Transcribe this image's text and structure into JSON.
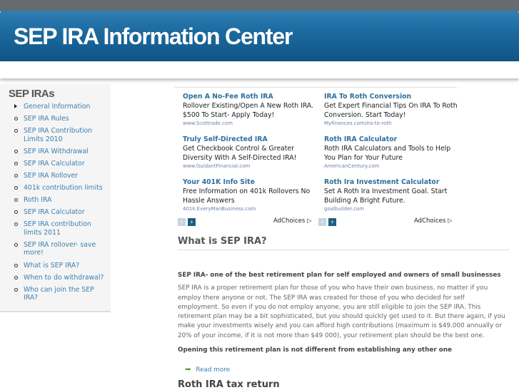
{
  "header": {
    "title": "SEP IRA Information Center"
  },
  "sidebar": {
    "title": "SEP IRAs",
    "items": [
      "General Information",
      "SEP IRA Rules",
      "SEP IRA Contribution Limits 2010",
      "SEP IRA Withdrawal",
      "SEP IRA Calculator",
      "SEP IRA Rollover",
      "401k contribution limits",
      "Roth IRA",
      "SEP IRA Calculator",
      "SEP IRA contribution limits 2011",
      "SEP IRA rollover- save more!",
      "What is SEP IRA?",
      "When to do withdrawal?",
      "Who can join the SEP IRA?"
    ]
  },
  "ads": {
    "left": [
      {
        "title": "Open A No-Fee Roth IRA",
        "desc": "Rollover Existing/Open A New Roth IRA. $500 To Start- Apply Today!",
        "url": "www.Scottrade.com"
      },
      {
        "title": "Truly Self-Directed IRA",
        "desc": "Get Checkbook Control & Greater Diversity With A Self-Directed IRA!",
        "url": "www.GuidantFinancial.com"
      },
      {
        "title": "Your 401K Info Site",
        "desc": "Free Information on 401k Rollovers No Hassle Answers",
        "url": "401k.EveryManBusiness.com"
      }
    ],
    "right": [
      {
        "title": "IRA To Roth Conversion",
        "desc": "Get Expert Financial Tips On IRA To Roth Conversion. Start Today!",
        "url": "Myfinances.com/ira-to-roth"
      },
      {
        "title": "Roth IRA Calculator",
        "desc": "Roth IRA Calculators and Tools to Help You Plan for Your Future",
        "url": "AmericanCentury.com"
      },
      {
        "title": "Roth Ira Investment Calculator",
        "desc": "Set A Roth Ira Investment Goal. Start Building A Bright Future.",
        "url": "goalbuilder.com"
      }
    ],
    "adchoices": "AdChoices",
    "prev": "‹",
    "next": "›"
  },
  "article": {
    "heading": "What is SEP IRA?",
    "subheading": "SEP IRA- one of the best retirement plan for self employed and owners of small businesses",
    "body": "SEP IRA is a proper retirement plan for those of you who have their own business, no matter if you employ there anyone or not. The SEP IRA was created for those of you who decided for self employment. So even if you do not employ anyone, you are still eligible to join the SEP IRA. This retirement plan may be a bit sophisticated, but you should quickly get used to it. But there again, if you make your investments wisely and you can afford high contributions (maximum is $49.000 annually or 20% of your income, if it is not more than $49 000), your retirement plan should be the best one.",
    "bold2": "Opening this retirement plan is not different from establishing any other one",
    "read_more": "Read more",
    "next_heading": "Roth IRA tax return"
  }
}
